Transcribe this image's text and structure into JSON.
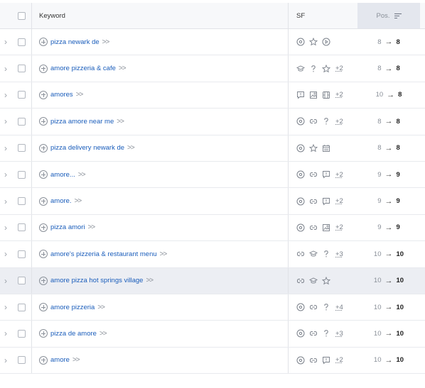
{
  "header": {
    "keyword_label": "Keyword",
    "sf_label": "SF",
    "pos_label": "Pos."
  },
  "rows": [
    {
      "keyword": "pizza newark de",
      "sf_icons": [
        "map-pin",
        "star",
        "play"
      ],
      "more": "",
      "from": "8",
      "to": "8"
    },
    {
      "keyword": "amore pizzeria & cafe",
      "sf_icons": [
        "graduation-cap",
        "question",
        "star"
      ],
      "more": "+2",
      "from": "8",
      "to": "8"
    },
    {
      "keyword": "amores",
      "sf_icons": [
        "comment",
        "image",
        "film"
      ],
      "more": "+2",
      "from": "10",
      "to": "8"
    },
    {
      "keyword": "pizza amore near me",
      "sf_icons": [
        "map-pin",
        "link",
        "question"
      ],
      "more": "+2",
      "from": "8",
      "to": "8"
    },
    {
      "keyword": "pizza delivery newark de",
      "sf_icons": [
        "map-pin",
        "star",
        "calendar"
      ],
      "more": "",
      "from": "8",
      "to": "8"
    },
    {
      "keyword": "amore...",
      "sf_icons": [
        "map-pin",
        "link",
        "comment"
      ],
      "more": "+2",
      "from": "9",
      "to": "9"
    },
    {
      "keyword": "amore.",
      "sf_icons": [
        "map-pin",
        "link",
        "comment"
      ],
      "more": "+2",
      "from": "9",
      "to": "9"
    },
    {
      "keyword": "pizza amori",
      "sf_icons": [
        "map-pin",
        "link",
        "image"
      ],
      "more": "+2",
      "from": "9",
      "to": "9"
    },
    {
      "keyword": "amore's pizzeria & restaurant menu",
      "sf_icons": [
        "link",
        "graduation-cap",
        "question"
      ],
      "more": "+3",
      "from": "10",
      "to": "10"
    },
    {
      "keyword": "amore pizza hot springs village",
      "sf_icons": [
        "link",
        "graduation-cap",
        "star"
      ],
      "more": "",
      "from": "10",
      "to": "10"
    },
    {
      "keyword": "amore pizzeria",
      "sf_icons": [
        "map-pin",
        "link",
        "question"
      ],
      "more": "+4",
      "from": "10",
      "to": "10"
    },
    {
      "keyword": "pizza de amore",
      "sf_icons": [
        "map-pin",
        "link",
        "question"
      ],
      "more": "+3",
      "from": "10",
      "to": "10"
    },
    {
      "keyword": "amore",
      "sf_icons": [
        "map-pin",
        "link",
        "comment"
      ],
      "more": "+2",
      "from": "10",
      "to": "10"
    }
  ],
  "highlight_row_index": 9,
  "colors": {
    "link": "#1a5dbb",
    "border": "#e8eaee",
    "highlight": "#eceef3"
  }
}
